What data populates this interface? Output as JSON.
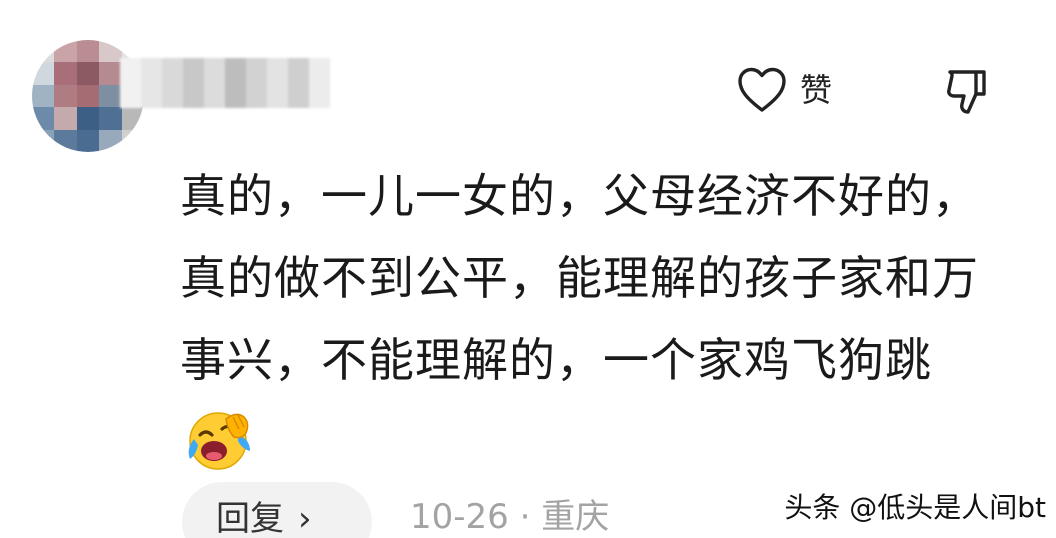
{
  "comment": {
    "like_label": "赞",
    "text": "真的，一儿一女的，父母经济不好的，真的做不到公平，能理解的孩子家和万事兴，不能理解的，一个家鸡飞狗跳",
    "emoji": "laughing-crying-emoji",
    "reply_label": "回复",
    "reply_chevron": "›",
    "date": "10-26",
    "separator": "·",
    "location": "重庆"
  },
  "watermark": "头条 @低头是人间bt",
  "icons": {
    "like": "heart-outline-icon",
    "dislike": "thumbs-down-outline-icon",
    "reply": "chevron-right-icon"
  },
  "colors": {
    "text": "#1a1a1a",
    "meta": "#a3a3a3",
    "reply_bg": "#f2f2f2",
    "emoji_face": "#ffcc33",
    "emoji_tears": "#3fa9f5"
  }
}
